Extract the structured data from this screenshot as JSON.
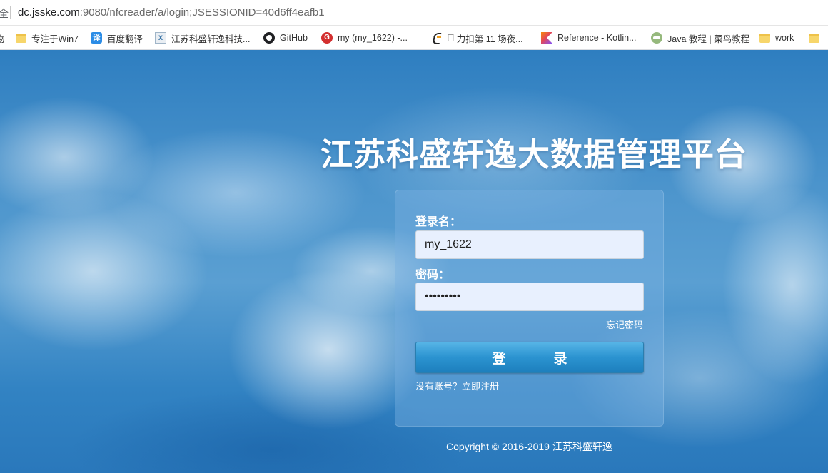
{
  "browser": {
    "address_prefix": "全",
    "url_host": "dc.jsske.com",
    "url_rest": ":9080/nfcreader/a/login;JSESSIONID=40d6ff4eafb1",
    "bookmarks": [
      {
        "label": "专注于Win7",
        "icon": "folder-icon"
      },
      {
        "label": "百度翻译",
        "icon": "translate-icon",
        "icon_text": "译"
      },
      {
        "label": "江苏科盛轩逸科技...",
        "icon": "company-icon",
        "icon_text": "X"
      },
      {
        "label": "GitHub",
        "icon": "github-icon"
      },
      {
        "label": "my (my_1622) -...",
        "icon": "g-icon",
        "icon_text": "G"
      },
      {
        "label": "力扣第 11 场夜...",
        "icon": "leetcode-icon",
        "prefix": "🀆"
      },
      {
        "label": "Reference - Kotlin...",
        "icon": "kotlin-icon"
      },
      {
        "label": "Java 教程 | 菜鸟教程",
        "icon": "runoob-icon"
      },
      {
        "label": "work",
        "icon": "folder-icon"
      }
    ]
  },
  "page": {
    "title": "江苏科盛轩逸大数据管理平台",
    "copyright": "Copyright © 2016-2019 江苏科盛轩逸"
  },
  "login": {
    "username_label": "登录名：",
    "username_value": "my_1622",
    "password_label": "密码：",
    "password_value": "123456789",
    "forgot_password": "忘记密码",
    "login_button": "登　录",
    "register_link": "没有账号？立即注册"
  }
}
